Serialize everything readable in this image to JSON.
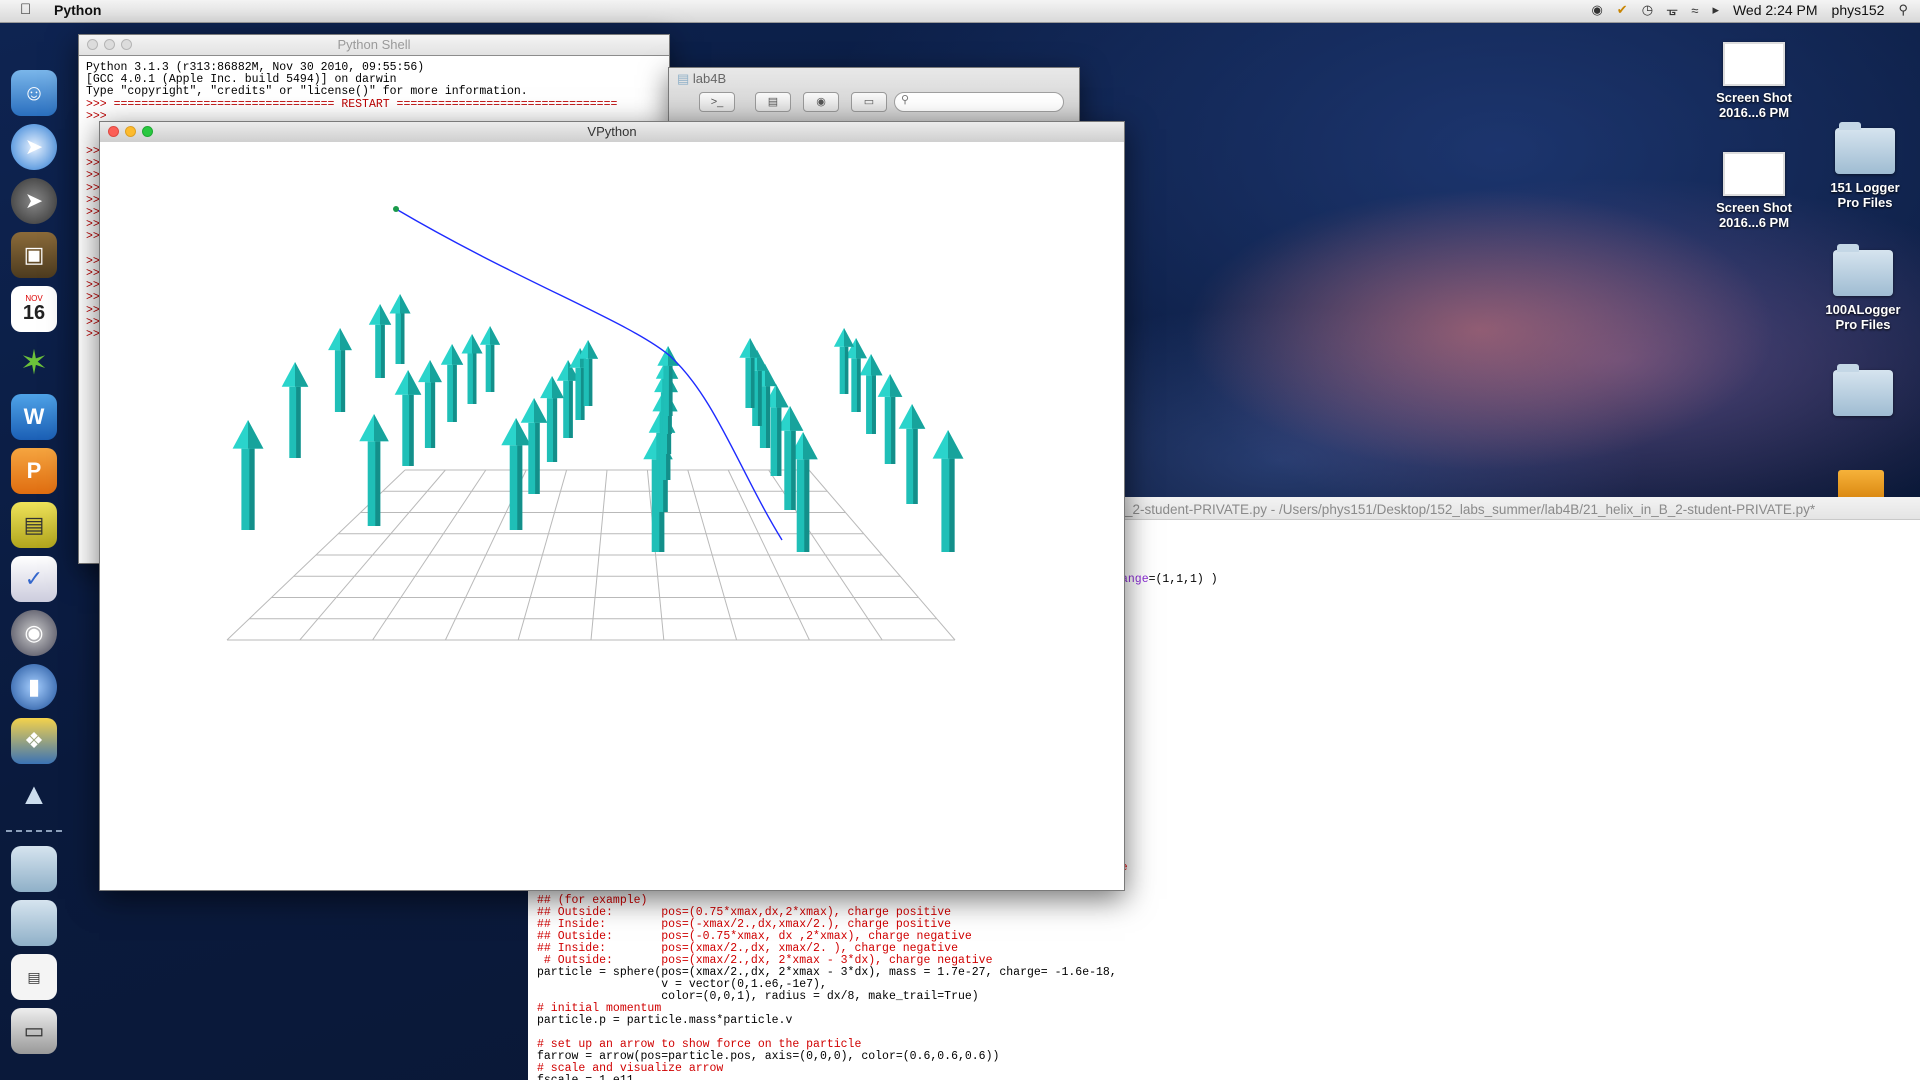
{
  "menubar": {
    "app_name": "Python",
    "clock": "Wed 2:24 PM",
    "user": "phys152"
  },
  "dock": {
    "calendar_month": "NOV",
    "calendar_day": "16"
  },
  "desktop_icons": [
    {
      "label1": "Screen Shot",
      "label2": "2016...6 PM"
    },
    {
      "label1": "Screen Shot",
      "label2": "2016...6 PM"
    },
    {
      "label1": "151 Logger",
      "label2": "Pro Files"
    },
    {
      "label1": "100ALogger",
      "label2": "Pro Files"
    }
  ],
  "python_shell": {
    "title": "Python Shell",
    "lines": [
      "Python 3.1.3 (r313:86882M, Nov 30 2010, 09:55:56)",
      "[GCC 4.0.1 (Apple Inc. build 5494)] on darwin",
      "Type \"copyright\", \"credits\" or \"license()\" for more information.",
      ">>> ================================ RESTART ================================",
      ">>>"
    ],
    "prompts": ">>>\n>>>\n>>>\n>>>\n>>>\n>>>\n>>>\n>>>\n\n>>>\n>>>\n>>>\n>>>\n>>>\n>>>\n>>>"
  },
  "finder": {
    "title": "lab4B",
    "search_placeholder": ""
  },
  "editor": {
    "title": "_2-student-PRIVATE.py - /Users/phys151/Desktop/152_labs_summer/lab4B/21_helix_in_B_2-student-PRIVATE.py*",
    "partial_line": "ange=(1,1,1) )",
    "lines": [
      {
        "t": "## (for example)",
        "c": "c-red"
      },
      {
        "t": "## Outside:       pos=(0.75*xmax,dx,2*xmax), charge positive",
        "c": "c-red"
      },
      {
        "t": "## Inside:        pos=(-xmax/2.,dx,xmax/2.), charge positive",
        "c": "c-red"
      },
      {
        "t": "## Outside:       pos=(-0.75*xmax, dx ,2*xmax), charge negative",
        "c": "c-red"
      },
      {
        "t": "## Inside:        pos=(xmax/2.,dx, xmax/2. ), charge negative",
        "c": "c-red"
      },
      {
        "t": " # Outside:       pos=(xmax/2.,dx, 2*xmax - 3*dx), charge negative",
        "c": "c-red"
      },
      {
        "t": "particle = sphere(pos=(xmax/2.,dx, 2*xmax - 3*dx), mass = 1.7e-27, charge= -1.6e-18,",
        "c": "c-blk"
      },
      {
        "t": "                  v = vector(0,1.e6,-1e7),",
        "c": "c-blk"
      },
      {
        "t": "                  color=(0,0,1), radius = dx/8, make_trail=True)",
        "c": "c-blk"
      },
      {
        "t": "# initial momentum",
        "c": "c-red"
      },
      {
        "t": "particle.p = particle.mass*particle.v",
        "c": "c-blk"
      },
      {
        "t": "",
        "c": "c-blk"
      },
      {
        "t": "# set up an arrow to show force on the particle",
        "c": "c-red"
      },
      {
        "t": "farrow = arrow(pos=particle.pos, axis=(0,0,0), color=(0.6,0.6,0.6))",
        "c": "c-blk"
      },
      {
        "t": "# scale and visualize arrow",
        "c": "c-red"
      },
      {
        "t": "fscale = 1.e11",
        "c": "c-blk"
      }
    ]
  },
  "vpython": {
    "title": "VPython"
  }
}
